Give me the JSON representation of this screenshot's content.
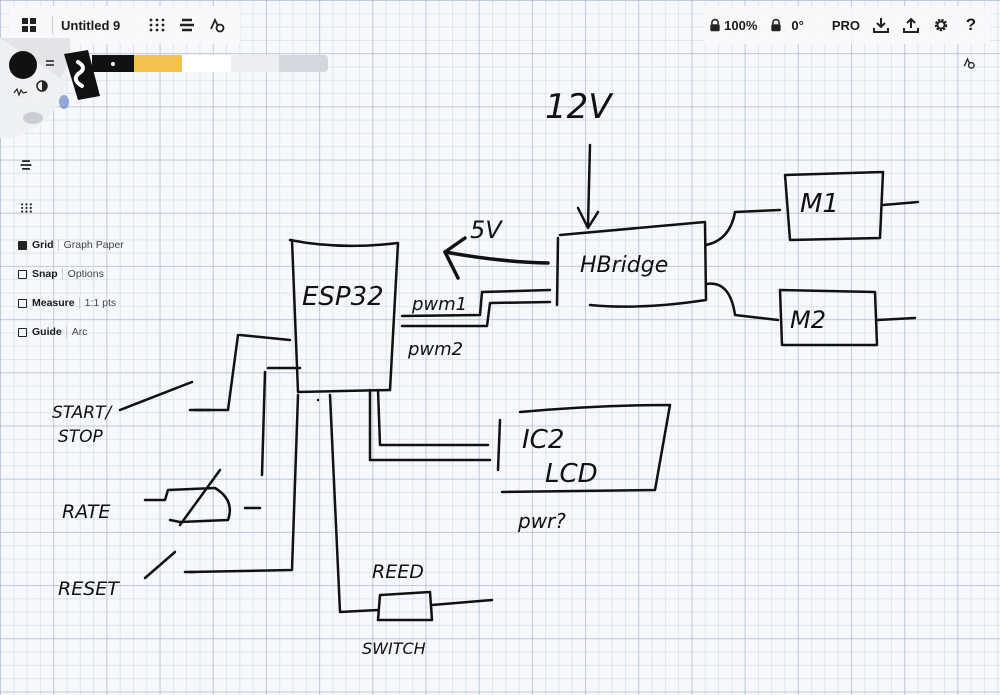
{
  "app": {
    "title": "Untitled 9"
  },
  "toolbar": {
    "zoom": "100%",
    "rotation": "0°",
    "pro_label": "PRO"
  },
  "colors": {
    "swatches": [
      "#111111",
      "#f2c14e",
      "#ffffff",
      "#eceef1",
      "#d3d8de"
    ],
    "ink": "#111111"
  },
  "side_options": [
    {
      "label": "Grid",
      "value": "Graph Paper",
      "checked": true
    },
    {
      "label": "Snap",
      "value": "Options",
      "checked": false
    },
    {
      "label": "Measure",
      "value": "1:1 pts",
      "checked": false
    },
    {
      "label": "Guide",
      "value": "Arc",
      "checked": false
    }
  ],
  "sketch_labels": {
    "v12": "12V",
    "v5": "5V",
    "esp32": "ESP32",
    "hbridge": "HBridge",
    "m1": "M1",
    "m2": "M2",
    "pwm1": "pwm1",
    "pwm2": "pwm2",
    "i2c": "IC2",
    "lcd": "LCD",
    "pwr": "pwr?",
    "start_stop_1": "START/",
    "start_stop_2": "STOP",
    "rate": "RATE",
    "reset": "RESET",
    "reed": "REED",
    "switch": "SWITCH"
  }
}
